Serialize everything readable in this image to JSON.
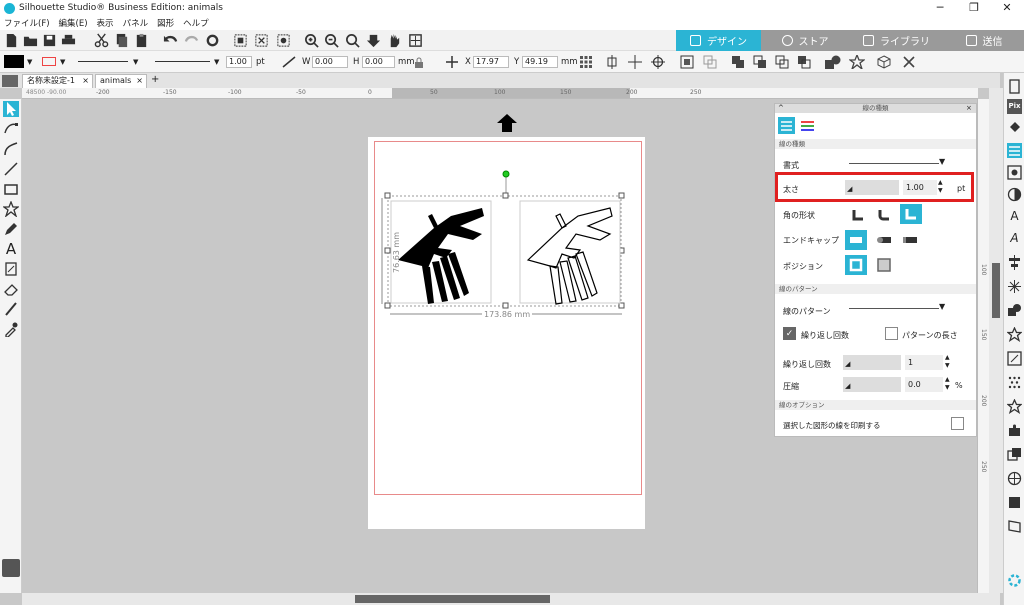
{
  "window": {
    "title": "Silhouette Studio® Business Edition: animals"
  },
  "menu": [
    "ファイル(F)",
    "編集(E)",
    "表示",
    "パネル",
    "図形",
    "ヘルプ"
  ],
  "tabs": [
    {
      "label": "デザイン",
      "active": true
    },
    {
      "label": "ストア",
      "active": false
    },
    {
      "label": "ライブラリ",
      "active": false
    },
    {
      "label": "送信",
      "active": false
    }
  ],
  "toolbar2": {
    "line_width": "1.00",
    "line_unit": "pt",
    "w_label": "W",
    "w_value": "0.00",
    "h_label": "H",
    "h_value": "0.00",
    "size_unit": "mm",
    "x_label": "X",
    "x_value": "17.97",
    "y_label": "Y",
    "y_value": "49.19",
    "pos_unit": "mm"
  },
  "doc_tabs": [
    {
      "label": "名称未設定-1"
    },
    {
      "label": "animals"
    }
  ],
  "ruler": {
    "corner": "48500 -90.00",
    "ticks": [
      "-200",
      "-150",
      "-100",
      "-50",
      "0",
      "50",
      "100",
      "150",
      "200",
      "250"
    ],
    "v_ticks": [
      "100",
      "150",
      "200",
      "250"
    ]
  },
  "dimensions": {
    "width": "173.86 mm",
    "height": "76.63 mm"
  },
  "panel": {
    "title": "線の種類",
    "sec_style": "線の種類",
    "style_label": "書式",
    "width_label": "太さ",
    "width_value": "1.00",
    "width_unit": "pt",
    "corner_label": "角の形状",
    "cap_label": "エンドキャップ",
    "position_label": "ポジション",
    "sec_pattern": "線のパターン",
    "pattern_label": "線のパターン",
    "repeat_check_label": "繰り返し回数",
    "pattern_length_label": "パターンの長さ",
    "repeat_label": "繰り返し回数",
    "repeat_value": "1",
    "compress_label": "圧縮",
    "compress_value": "0.0",
    "compress_unit": "%",
    "sec_options": "線のオプション",
    "print_label": "選択した図形の線を印刷する"
  },
  "colors": {
    "accent": "#2bb4d4",
    "highlight": "#e02020"
  }
}
